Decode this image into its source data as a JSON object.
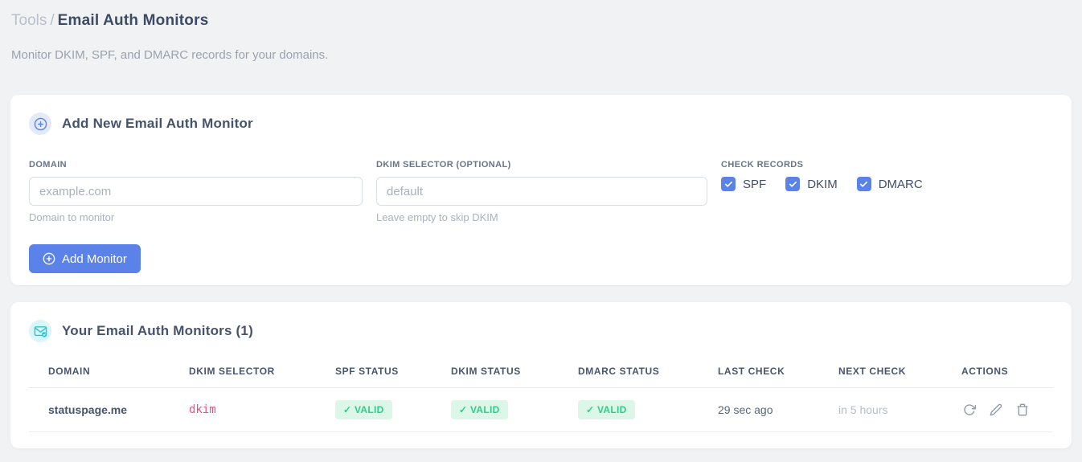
{
  "page": {
    "breadcrumb_root": "Tools",
    "breadcrumb_sep": "/",
    "title": "Email Auth Monitors",
    "subtitle": "Monitor DKIM, SPF, and DMARC records for your domains."
  },
  "add_card": {
    "title": "Add New Email Auth Monitor",
    "domain_field": {
      "label": "DOMAIN",
      "placeholder": "example.com",
      "value": "",
      "helper": "Domain to monitor"
    },
    "dkim_field": {
      "label": "DKIM SELECTOR (OPTIONAL)",
      "placeholder": "default",
      "value": "",
      "helper": "Leave empty to skip DKIM"
    },
    "check_records": {
      "label": "CHECK RECORDS",
      "options": [
        {
          "label": "SPF",
          "checked": true
        },
        {
          "label": "DKIM",
          "checked": true
        },
        {
          "label": "DMARC",
          "checked": true
        }
      ]
    },
    "submit_label": "Add Monitor"
  },
  "monitors_card": {
    "title": "Your Email Auth Monitors (1)",
    "count": 1,
    "table": {
      "headers": [
        "DOMAIN",
        "DKIM SELECTOR",
        "SPF STATUS",
        "DKIM STATUS",
        "DMARC STATUS",
        "LAST CHECK",
        "NEXT CHECK",
        "ACTIONS"
      ],
      "rows": [
        {
          "domain": "statuspage.me",
          "dkim_selector": "dkim",
          "spf_status": "✓ VALID",
          "dkim_status": "✓ VALID",
          "dmarc_status": "✓ VALID",
          "last_check": "29 sec ago",
          "next_check": "in 5 hours"
        }
      ]
    }
  },
  "colors": {
    "accent_blue": "#5a82e9",
    "badge_blue_bg": "#e4eafb",
    "teal": "#29c5d6",
    "badge_teal_bg": "#d9f6f8",
    "success_green": "#2dce89",
    "success_bg": "#dcf7e8",
    "code_pink": "#ed4e86",
    "page_bg": "#f1f2f4"
  }
}
